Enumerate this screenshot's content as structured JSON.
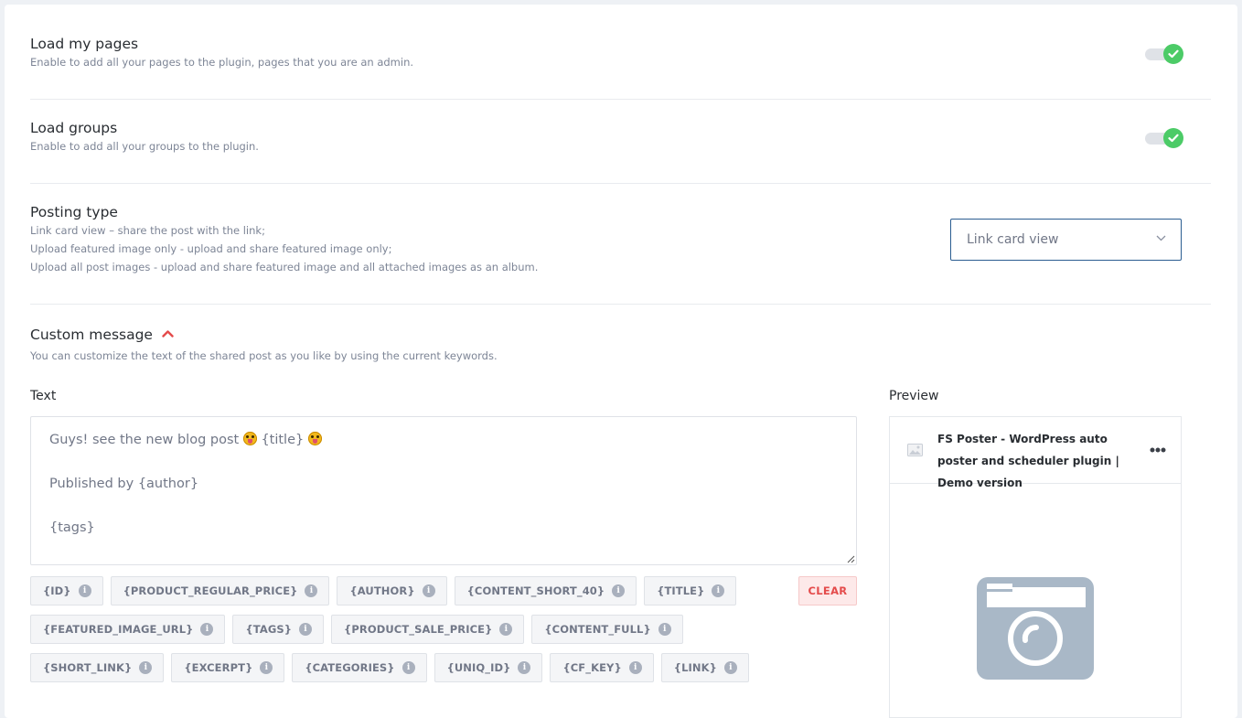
{
  "settings": [
    {
      "title": "Load my pages",
      "description": "Enable to add all your pages to the plugin, pages that you are an admin.",
      "enabled": true
    },
    {
      "title": "Load groups",
      "description": "Enable to add all your groups to the plugin.",
      "enabled": true
    }
  ],
  "posting_type": {
    "title": "Posting type",
    "descriptions": [
      "Link card view – share the post with the link;",
      "Upload featured image only - upload and share featured image only;",
      "Upload all post images - upload and share featured image and all attached images as an album."
    ],
    "selected": "Link card view"
  },
  "custom_message": {
    "title": "Custom message",
    "description": "You can customize the text of the shared post as you like by using the current keywords.",
    "text_label": "Text",
    "text_lines": [
      "Guys! see the new blog post",
      "{title}",
      "Published by {author}",
      "{tags}"
    ],
    "keywords_row1": [
      "{ID}",
      "{PRODUCT_REGULAR_PRICE}",
      "{AUTHOR}",
      "{CONTENT_SHORT_40}",
      "{TITLE}"
    ],
    "keywords_row2": [
      "{FEATURED_IMAGE_URL}",
      "{TAGS}",
      "{PRODUCT_SALE_PRICE}",
      "{CONTENT_FULL}"
    ],
    "keywords_row3": [
      "{SHORT_LINK}",
      "{EXCERPT}",
      "{CATEGORIES}",
      "{UNIQ_ID}",
      "{CF_KEY}",
      "{LINK}"
    ],
    "clear_label": "CLEAR"
  },
  "preview": {
    "label": "Preview",
    "title": "FS Poster - WordPress auto poster and scheduler plugin | Demo version"
  },
  "colors": {
    "toggle_on": "#4ccb67",
    "select_border": "#2b5d91",
    "clear": "#e44b4b",
    "caret": "#e44b4b"
  }
}
